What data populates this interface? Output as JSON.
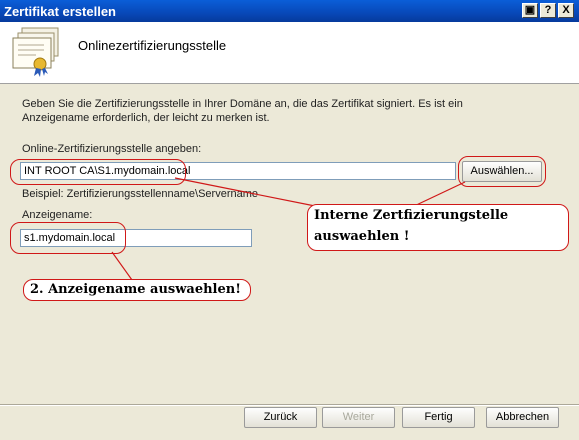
{
  "window": {
    "title": "Zertifikat erstellen",
    "buttons": [
      "▣",
      "?",
      "X"
    ]
  },
  "header": {
    "title": "Onlinezertifizierungsstelle"
  },
  "main": {
    "instruction_line1": "Geben Sie die Zertifizierungsstelle in Ihrer Domäne an, die das Zertifikat signiert. Es ist ein",
    "instruction_line2": "Anzeigename erforderlich, der leicht zu merken ist.",
    "ca_label": "Online-Zertifizierungsstelle angeben:",
    "ca_value": "INT ROOT CA\\S1.mydomain.local",
    "select_button": "Auswählen...",
    "example_text": "Beispiel: Zertifizierungsstellenname\\Servername",
    "friendly_label": "Anzeigename:",
    "friendly_value": "s1.mydomain.local"
  },
  "annotations": {
    "callout1_line1": "Interne Zertfizierungstelle",
    "callout1_line2": "auswaehlen !",
    "callout2": "2. Anzeigename auswaehlen!"
  },
  "footer": {
    "back": "Zurück",
    "next": "Weiter",
    "finish": "Fertig",
    "cancel": "Abbrechen"
  },
  "colors": {
    "titlebar": "#0848b8",
    "annotation": "#d01818",
    "dialog_bg": "#ece9d8"
  }
}
